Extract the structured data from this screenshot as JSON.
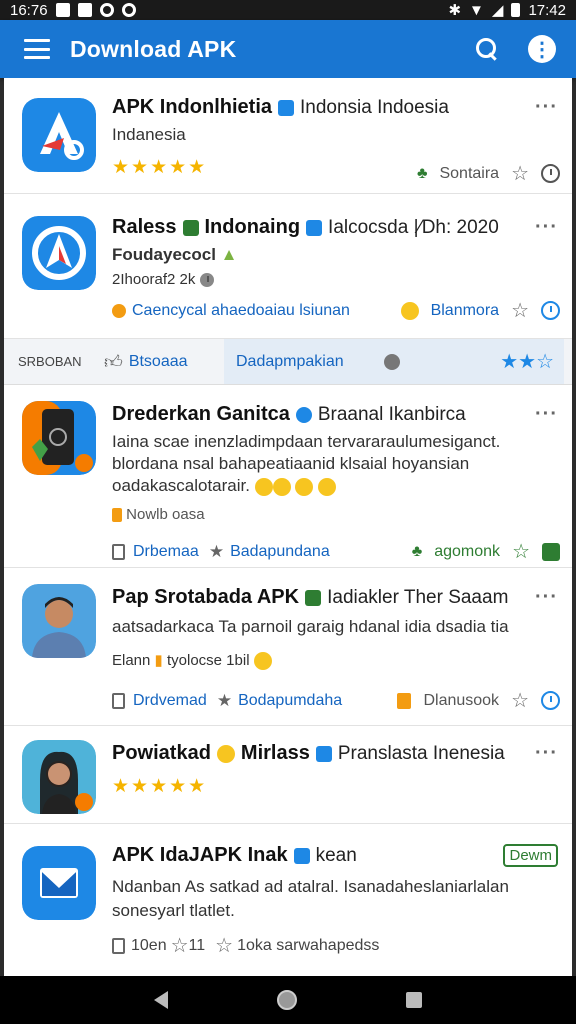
{
  "status_bar": {
    "time_left": "16:76",
    "time_right": "17:42"
  },
  "app_bar": {
    "title": "Download APK"
  },
  "apps": [
    {
      "name": "APK Indonlhietia",
      "subtitle": "Indonsia Indoesia",
      "line1": "Indanesia",
      "rating_stars": "★★★★★",
      "meta_right": "Sontaira"
    },
    {
      "name": "Raless",
      "name2": "Indonaing",
      "subtitle": "Ialcocsda |⁄Dh: 2020",
      "line1": "Foudayecocl",
      "line2": "2Ihooraf2 2k",
      "meta_left": "Caencycal ahaedoaiau lsiunan",
      "meta_right": "Blanmora"
    },
    {
      "name": "Drederkan Ganitca",
      "subtitle": "Braanal Ikanbirca",
      "line1": "Iaina scae  inenzladimpdaan tervararaulumesiganct.",
      "line2": "blordana nsal bahapeatiaanid klsaial hoyansian",
      "line3": "oadakascalotarair.",
      "line4": "Nowlb oasa",
      "meta_left": "Drbemaa",
      "meta_mid": "Badapundana",
      "meta_right": "agomonk"
    },
    {
      "name": "Pap Srotabada APK",
      "subtitle": "Iadiakler Ther Saaam",
      "line1": "aatsadarkaca Ta parnoil garaig hdanal idia dsadia tia",
      "line2": "Elann",
      "line2b": "tyolocse 1bil",
      "meta_left": "Drdvemad",
      "meta_mid": "Bodapumdaha",
      "meta_right": "Dlanusook"
    },
    {
      "name": "Powiatkad",
      "name2": "Mirlass",
      "subtitle": "Pranslasta Inenesia",
      "rating_stars": "★★★★★"
    },
    {
      "name": "APK IdaJAPK Inak",
      "subtitle": "kean",
      "badge": "Dewm",
      "line1": "Ndanban As satkad ad atalral. Isanadaheslaniarlalan",
      "line2": "sonesyarl tlatlet.",
      "meta_left": "10en",
      "meta_mid": "11",
      "meta_right": "1oka sarwahapedss"
    }
  ],
  "tab_strip": {
    "first": "SRBOBAN",
    "second": "Btsoaaa",
    "third": "Dadapmpakian"
  },
  "icons": [
    "menu-icon",
    "search-icon",
    "more-icon",
    "star-icon",
    "clock-icon",
    "leaf-icon",
    "bookmark-icon"
  ],
  "colors": {
    "brand": "#1976d2",
    "star": "#f5b400",
    "accent_green": "#2e7d32"
  }
}
